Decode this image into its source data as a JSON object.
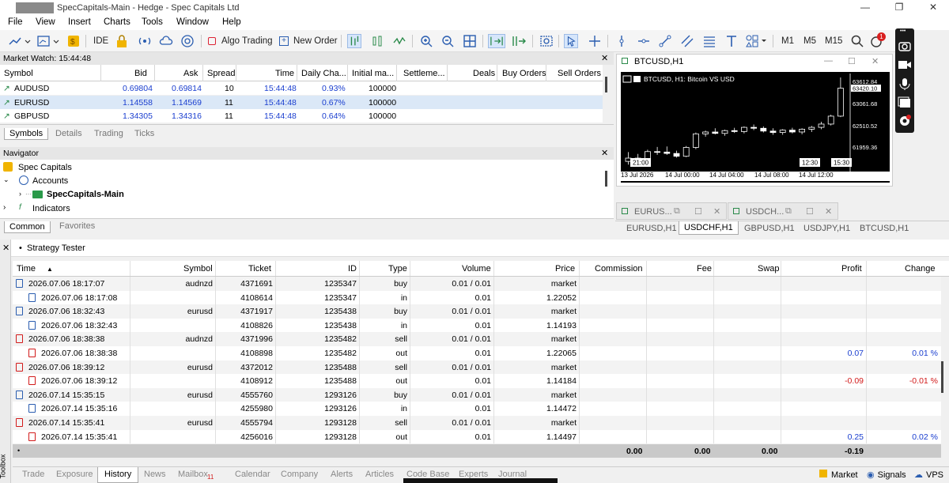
{
  "window": {
    "title": "SpecCapitals-Main - Hedge - Spec Capitals Ltd",
    "controls": [
      "—",
      "❐",
      "✕"
    ]
  },
  "menu": [
    "File",
    "View",
    "Insert",
    "Charts",
    "Tools",
    "Window",
    "Help"
  ],
  "toolbar": {
    "ide": "IDE",
    "algo_trading": "Algo Trading",
    "new_order": "New Order",
    "timeframes": [
      "M1",
      "M5",
      "M15"
    ],
    "notifications_badge": "1"
  },
  "market_watch": {
    "title": "Market Watch: 15:44:48",
    "columns": [
      "Symbol",
      "Bid",
      "Ask",
      "Spread",
      "Time",
      "Daily Cha...",
      "Initial ma...",
      "Settleme...",
      "Deals",
      "Buy Orders",
      "Sell Orders"
    ],
    "rows": [
      {
        "symbol": "AUDUSD",
        "bid": "0.69804",
        "ask": "0.69814",
        "spread": "10",
        "time": "15:44:48",
        "daily": "0.93%",
        "initial": "100000"
      },
      {
        "symbol": "EURUSD",
        "bid": "1.14558",
        "ask": "1.14569",
        "spread": "11",
        "time": "15:44:48",
        "daily": "0.67%",
        "initial": "100000"
      },
      {
        "symbol": "GBPUSD",
        "bid": "1.34305",
        "ask": "1.34316",
        "spread": "11",
        "time": "15:44:48",
        "daily": "0.64%",
        "initial": "100000"
      }
    ],
    "tabs": [
      "Symbols",
      "Details",
      "Trading",
      "Ticks"
    ]
  },
  "navigator": {
    "title": "Navigator",
    "items": [
      "Spec Capitals",
      "Accounts",
      "SpecCapitals-Main",
      "Indicators"
    ],
    "tabs": [
      "Common",
      "Favorites"
    ]
  },
  "chart": {
    "window_title": "BTCUSD,H1",
    "label": "BTCUSD, H1: Bitcoin VS USD",
    "price_labels": [
      "63612.84",
      "63061.68",
      "62510.52",
      "61959.36"
    ],
    "current_price": "63420.10",
    "time_labels": [
      "13 Jul 2026",
      "14 Jul 00:00",
      "14 Jul 04:00",
      "14 Jul 08:00",
      "14 Jul 12:00"
    ],
    "time_boxes": [
      "21:00",
      "12:30",
      "15:30"
    ],
    "minimized": [
      "EURUS...",
      "USDCH..."
    ],
    "tabs": [
      "EURUSD,H1",
      "USDCHF,H1",
      "GBPUSD,H1",
      "USDJPY,H1",
      "BTCUSD,H1"
    ],
    "candles": [
      {
        "o": 61850,
        "h": 62050,
        "l": 61780,
        "c": 61920
      },
      {
        "o": 61920,
        "h": 62010,
        "l": 61850,
        "c": 61890
      },
      {
        "o": 61890,
        "h": 62100,
        "l": 61860,
        "c": 62060
      },
      {
        "o": 62060,
        "h": 62160,
        "l": 61990,
        "c": 62050
      },
      {
        "o": 62050,
        "h": 62170,
        "l": 61990,
        "c": 62020
      },
      {
        "o": 62020,
        "h": 62080,
        "l": 61930,
        "c": 61960
      },
      {
        "o": 61960,
        "h": 62180,
        "l": 61940,
        "c": 62150
      },
      {
        "o": 62150,
        "h": 62470,
        "l": 62110,
        "c": 62440
      },
      {
        "o": 62440,
        "h": 62510,
        "l": 62380,
        "c": 62480
      },
      {
        "o": 62480,
        "h": 62560,
        "l": 62430,
        "c": 62450
      },
      {
        "o": 62450,
        "h": 62530,
        "l": 62400,
        "c": 62510
      },
      {
        "o": 62510,
        "h": 62570,
        "l": 62460,
        "c": 62490
      },
      {
        "o": 62490,
        "h": 62600,
        "l": 62450,
        "c": 62580
      },
      {
        "o": 62580,
        "h": 62640,
        "l": 62520,
        "c": 62560
      },
      {
        "o": 62560,
        "h": 62600,
        "l": 62470,
        "c": 62500
      },
      {
        "o": 62500,
        "h": 62560,
        "l": 62420,
        "c": 62470
      },
      {
        "o": 62470,
        "h": 62540,
        "l": 62420,
        "c": 62520
      },
      {
        "o": 62520,
        "h": 62570,
        "l": 62450,
        "c": 62480
      },
      {
        "o": 62480,
        "h": 62560,
        "l": 62430,
        "c": 62540
      },
      {
        "o": 62540,
        "h": 62610,
        "l": 62480,
        "c": 62580
      },
      {
        "o": 62580,
        "h": 62700,
        "l": 62540,
        "c": 62650
      },
      {
        "o": 62650,
        "h": 62850,
        "l": 62620,
        "c": 62820
      },
      {
        "o": 62820,
        "h": 63650,
        "l": 62800,
        "c": 63420
      }
    ]
  },
  "strategy_tester": {
    "label": "Strategy Tester"
  },
  "history": {
    "columns": [
      "Time",
      "Symbol",
      "Ticket",
      "ID",
      "Type",
      "Volume",
      "Price",
      "Commission",
      "Fee",
      "Swap",
      "Profit",
      "Change"
    ],
    "rows": [
      {
        "kind": "order",
        "color": "blue",
        "time": "2026.07.06 18:17:07",
        "symbol": "audnzd",
        "ticket": "4371691",
        "id": "1235347",
        "type": "buy",
        "volume": "0.01 / 0.01",
        "price": "market",
        "profit": "",
        "change": ""
      },
      {
        "kind": "deal",
        "color": "blue",
        "time": "2026.07.06 18:17:08",
        "symbol": "",
        "ticket": "4108614",
        "id": "1235347",
        "type": "in",
        "volume": "0.01",
        "price": "1.22052",
        "profit": "",
        "change": ""
      },
      {
        "kind": "order",
        "color": "blue",
        "time": "2026.07.06 18:32:43",
        "symbol": "eurusd",
        "ticket": "4371917",
        "id": "1235438",
        "type": "buy",
        "volume": "0.01 / 0.01",
        "price": "market",
        "profit": "",
        "change": ""
      },
      {
        "kind": "deal",
        "color": "blue",
        "time": "2026.07.06 18:32:43",
        "symbol": "",
        "ticket": "4108826",
        "id": "1235438",
        "type": "in",
        "volume": "0.01",
        "price": "1.14193",
        "profit": "",
        "change": ""
      },
      {
        "kind": "order",
        "color": "red",
        "time": "2026.07.06 18:38:38",
        "symbol": "audnzd",
        "ticket": "4371996",
        "id": "1235482",
        "type": "sell",
        "volume": "0.01 / 0.01",
        "price": "market",
        "profit": "",
        "change": ""
      },
      {
        "kind": "deal",
        "color": "red",
        "time": "2026.07.06 18:38:38",
        "symbol": "",
        "ticket": "4108898",
        "id": "1235482",
        "type": "out",
        "volume": "0.01",
        "price": "1.22065",
        "profit": "0.07",
        "change": "0.01 %"
      },
      {
        "kind": "order",
        "color": "red",
        "time": "2026.07.06 18:39:12",
        "symbol": "eurusd",
        "ticket": "4372012",
        "id": "1235488",
        "type": "sell",
        "volume": "0.01 / 0.01",
        "price": "market",
        "profit": "",
        "change": ""
      },
      {
        "kind": "deal",
        "color": "red",
        "time": "2026.07.06 18:39:12",
        "symbol": "",
        "ticket": "4108912",
        "id": "1235488",
        "type": "out",
        "volume": "0.01",
        "price": "1.14184",
        "profit": "-0.09",
        "change": "-0.01 %"
      },
      {
        "kind": "order",
        "color": "blue",
        "time": "2026.07.14 15:35:15",
        "symbol": "eurusd",
        "ticket": "4555760",
        "id": "1293126",
        "type": "buy",
        "volume": "0.01 / 0.01",
        "price": "market",
        "profit": "",
        "change": ""
      },
      {
        "kind": "deal",
        "color": "blue",
        "time": "2026.07.14 15:35:16",
        "symbol": "",
        "ticket": "4255980",
        "id": "1293126",
        "type": "in",
        "volume": "0.01",
        "price": "1.14472",
        "profit": "",
        "change": ""
      },
      {
        "kind": "order",
        "color": "red",
        "time": "2026.07.14 15:35:41",
        "symbol": "eurusd",
        "ticket": "4555794",
        "id": "1293128",
        "type": "sell",
        "volume": "0.01 / 0.01",
        "price": "market",
        "profit": "",
        "change": ""
      },
      {
        "kind": "deal",
        "color": "red",
        "time": "2026.07.14 15:35:41",
        "symbol": "",
        "ticket": "4256016",
        "id": "1293128",
        "type": "out",
        "volume": "0.01",
        "price": "1.14497",
        "profit": "0.25",
        "change": "0.02 %"
      }
    ],
    "totals": {
      "commission": "0.00",
      "fee": "0.00",
      "swap": "0.00",
      "profit": "-0.19"
    }
  },
  "bottom_tabs": [
    "Trade",
    "Exposure",
    "History",
    "News",
    "Mailbox",
    "Calendar",
    "Company",
    "Alerts",
    "Articles",
    "Code Base",
    "Experts",
    "Journal"
  ],
  "mailbox_badge": "11",
  "toolbox_label": "Toolbox",
  "status": {
    "market": "Market",
    "signals": "Signals",
    "vps": "VPS"
  }
}
